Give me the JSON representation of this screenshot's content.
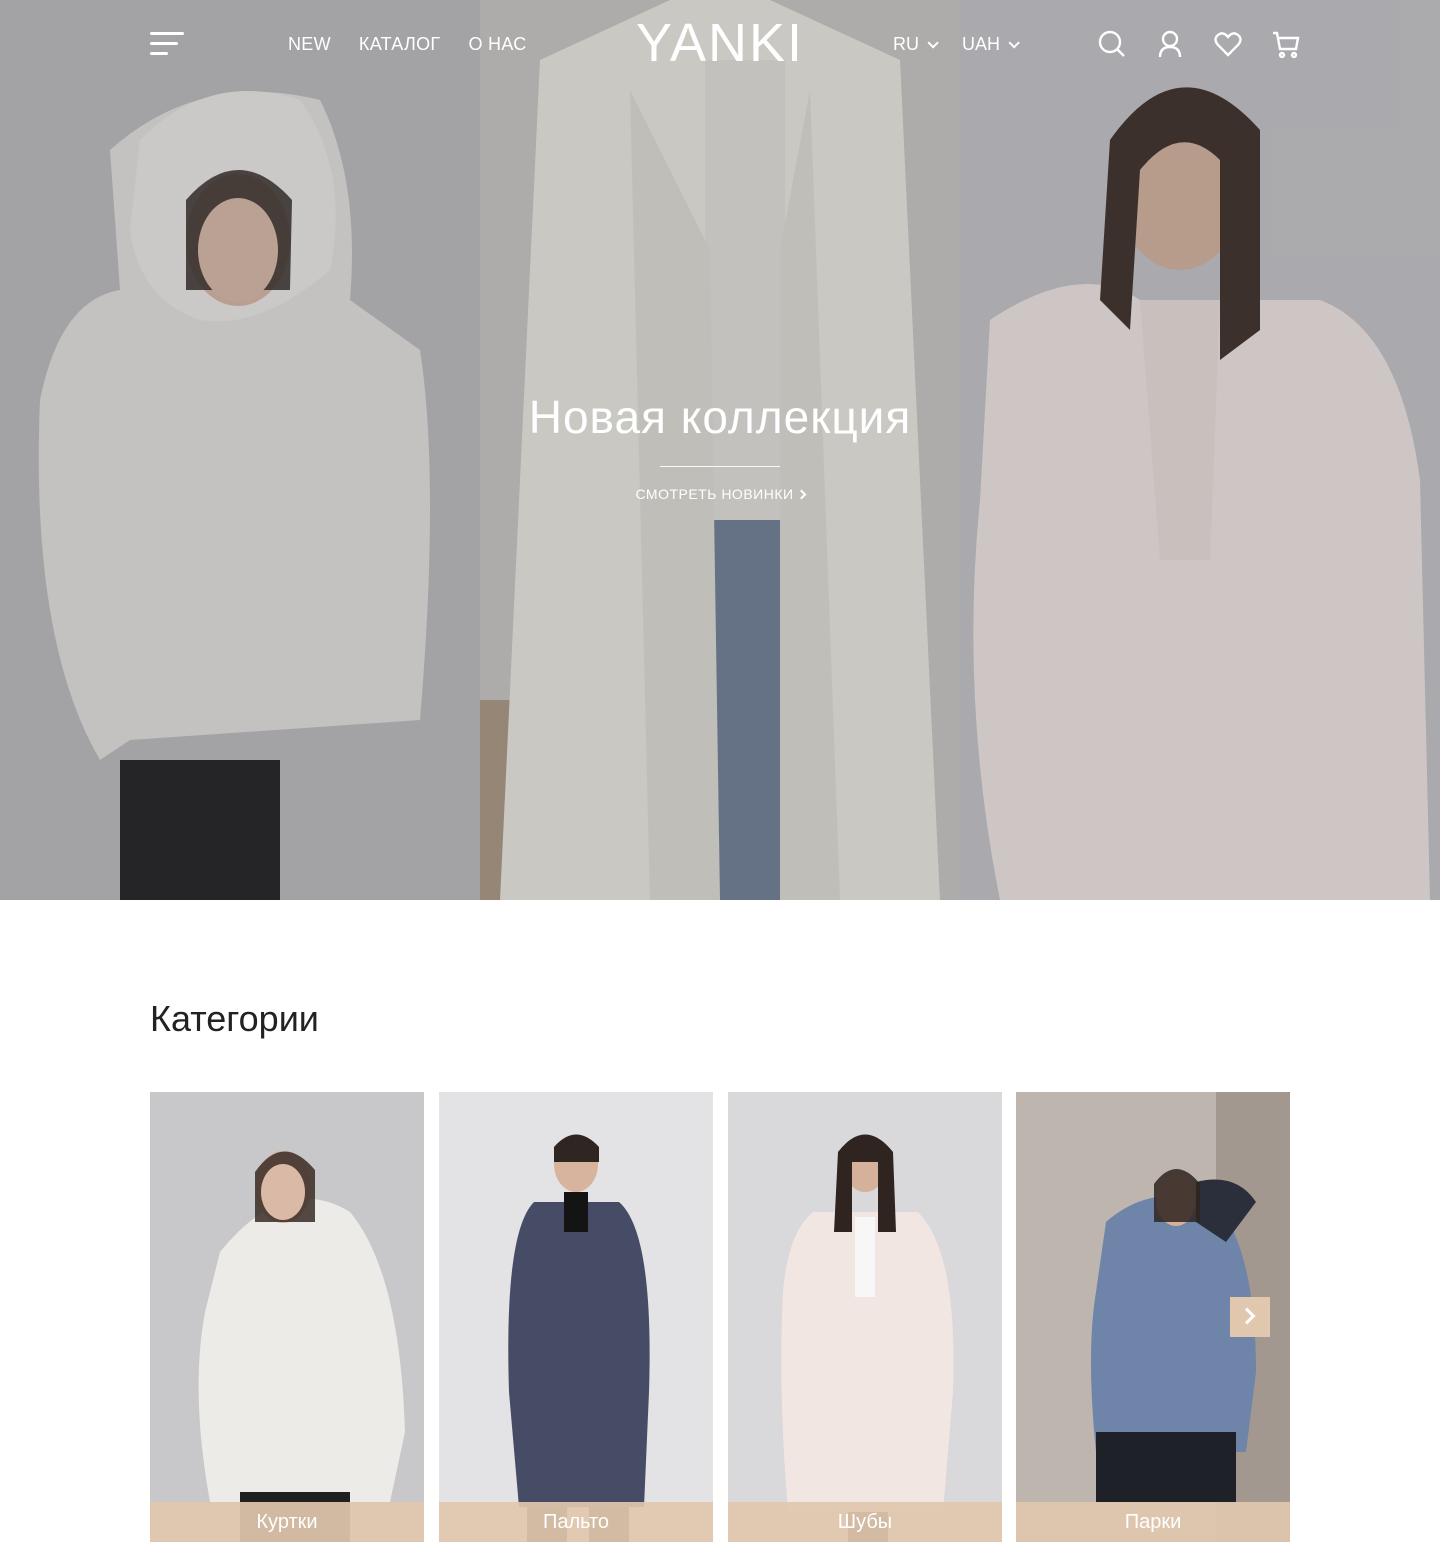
{
  "header": {
    "nav": [
      "NEW",
      "КАТАЛОГ",
      "О НАС"
    ],
    "logo": "YANKI",
    "language": "RU",
    "currency": "UAH"
  },
  "hero": {
    "title": "Новая коллекция",
    "cta": "СМОТРЕТЬ НОВИНКИ"
  },
  "categories": {
    "title": "Категории",
    "items": [
      {
        "label": "Куртки"
      },
      {
        "label": "Пальто"
      },
      {
        "label": "Шубы"
      },
      {
        "label": "Парки"
      }
    ]
  },
  "colors": {
    "accent": "#e1c7ae"
  }
}
